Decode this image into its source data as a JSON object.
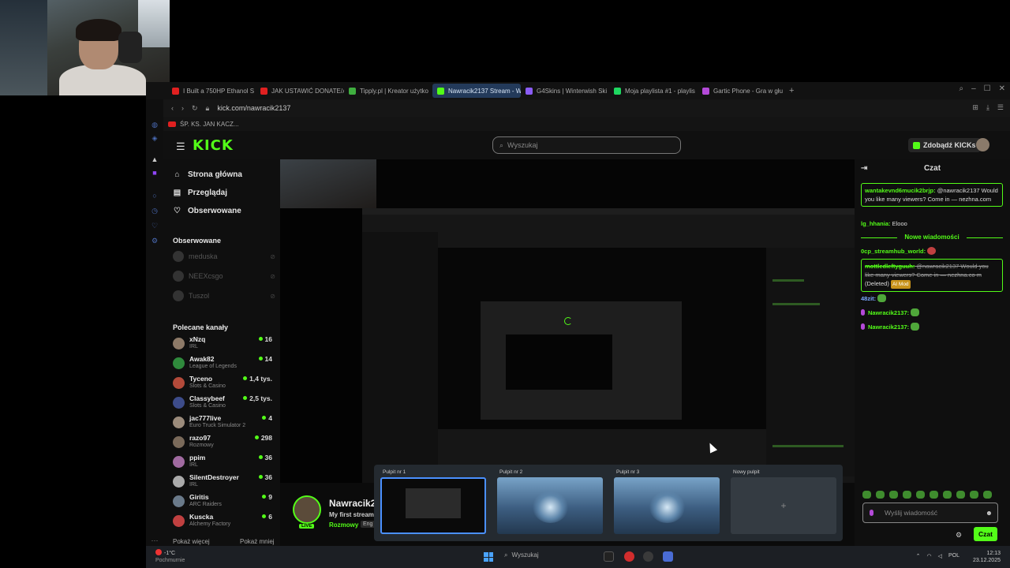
{
  "tabs": [
    {
      "label": "I Built a 750HP Ethanol S",
      "color": "#e02020",
      "active": false
    },
    {
      "label": "JAK USTAWIĆ DONATE/A",
      "color": "#e02020",
      "active": false
    },
    {
      "label": "Tipply.pl | Kreator użytko",
      "color": "#3fae3f",
      "active": false
    },
    {
      "label": "Nawracik2137 Stream - W",
      "color": "#53fc18",
      "active": true
    },
    {
      "label": "G4Skins | Winterwish Ski",
      "color": "#8a5cf5",
      "active": false
    },
    {
      "label": "Moja playlista #1 - playlis",
      "color": "#1ed760",
      "active": false
    },
    {
      "label": "Gartic Phone - Gra w głu",
      "color": "#b44ad8",
      "active": false
    }
  ],
  "address": {
    "url": "kick.com/nawracik2137"
  },
  "bookmarks": {
    "item": "ŚP. KS. JAN KACZ..."
  },
  "kick": {
    "logo": "KICK",
    "search_placeholder": "Wyszukaj",
    "kicks_button": "Zdobądź KICKs"
  },
  "nav": {
    "home": "Strona główna",
    "browse": "Przeglądaj",
    "following": "Obserwowane"
  },
  "followed": {
    "title": "Obserwowane",
    "items": [
      "meduska",
      "NEEXcsgo",
      "Tuszol"
    ]
  },
  "recommended": {
    "title": "Polecane kanały",
    "items": [
      {
        "name": "xNzq",
        "category": "IRL",
        "viewers": "16",
        "color": "#8d7a68"
      },
      {
        "name": "Awak82",
        "category": "League of Legends",
        "viewers": "14",
        "color": "#2f8a3c"
      },
      {
        "name": "Tyceno",
        "category": "Slots & Casino",
        "viewers": "1,4 tys.",
        "color": "#b34a3a"
      },
      {
        "name": "Classybeef",
        "category": "Slots & Casino",
        "viewers": "2,5 tys.",
        "color": "#3d4c8a"
      },
      {
        "name": "jac777live",
        "category": "Euro Truck Simulator 2",
        "viewers": "4",
        "color": "#9b8b7b"
      },
      {
        "name": "razo97",
        "category": "Rozmowy",
        "viewers": "298",
        "color": "#7a6a5a"
      },
      {
        "name": "ppim",
        "category": "IRL",
        "viewers": "36",
        "color": "#a06aa0"
      },
      {
        "name": "SilentDestroyer",
        "category": "IRL",
        "viewers": "36",
        "color": "#aaaaaa"
      },
      {
        "name": "Giritis",
        "category": "ARC Raiders",
        "viewers": "9",
        "color": "#6a7a8a"
      },
      {
        "name": "Kuscka",
        "category": "Alchemy Factory",
        "viewers": "6",
        "color": "#c04040"
      }
    ],
    "show_more": "Pokaż więcej",
    "show_less": "Pokaż mniej"
  },
  "streamer": {
    "name": "Nawracik2",
    "title": "My first stream",
    "category": "Rozmowy",
    "language": "Eng",
    "live": "LIVE"
  },
  "chat": {
    "title": "Czat",
    "m1_user": "wantakevnd6mucik2brjp:",
    "m1_text": " @nawracik2137 Would you like many viewers? Come in — nezhna.com",
    "m2_user": "lg_hhania:",
    "m2_text": " Elooo",
    "new_messages": "Nowe wiadomości",
    "m3_user": "0cp_streamhub_world:",
    "m4_user": "mottledleftyguuh:",
    "m4_text": " @nawracik2137 Would you like many viewers? Come in — nezhna.co m",
    "m4_deleted": "(Deleted)",
    "m4_badge": "AI Mod",
    "m5_user": "48zit:",
    "m6_user": "Nawracik2137:",
    "m7_user": "Nawracik2137:",
    "input_placeholder": "Wyślij wiadomość",
    "send": "Czat"
  },
  "desktops": [
    {
      "label": "Pulpit nr 1",
      "style": "dark"
    },
    {
      "label": "Pulpit nr 2",
      "style": "blue"
    },
    {
      "label": "Pulpit nr 3",
      "style": "blue"
    },
    {
      "label": "Nowy pulpit",
      "style": "new"
    }
  ],
  "desktop_add": "+",
  "taskbar": {
    "temp": "-1°C",
    "weather": "Pochmurnie",
    "search": "Wyszukaj",
    "lang": "POL",
    "time": "12:13",
    "date": "23.12.2025"
  }
}
